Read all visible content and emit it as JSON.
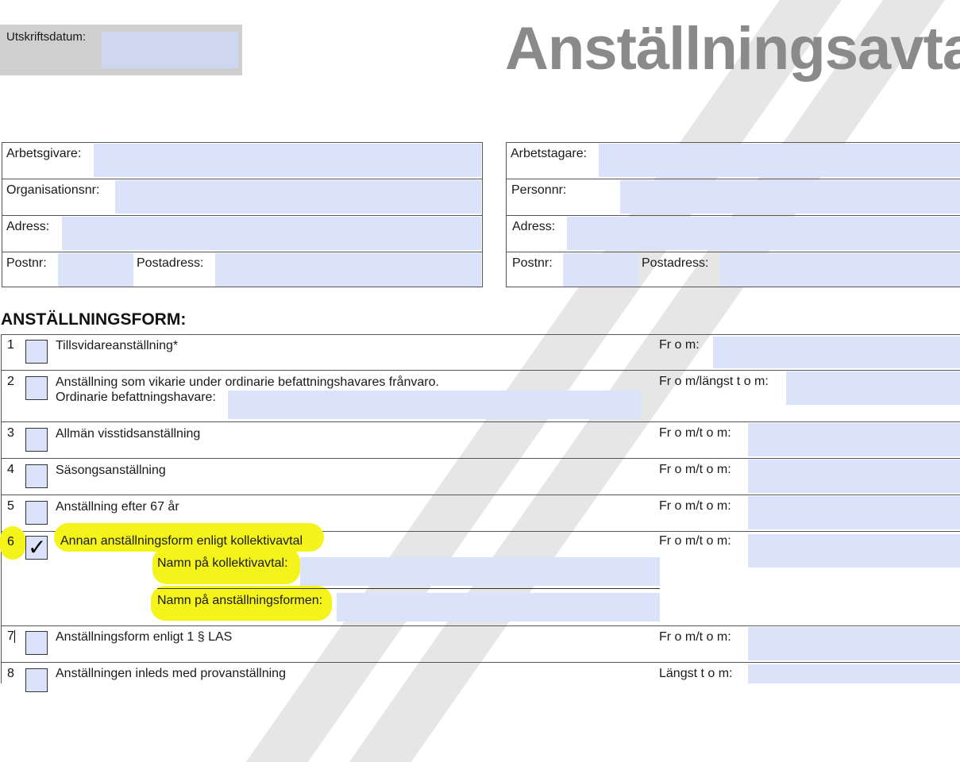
{
  "header": {
    "print_date_label": "Utskriftsdatum:",
    "title": "Anställningsavta"
  },
  "employer": {
    "employer_label": "Arbetsgivare:",
    "org_label": "Organisationsnr:",
    "address_label": "Adress:",
    "postal_code_label": "Postnr:",
    "postal_address_label": "Postadress:"
  },
  "employee": {
    "employee_label": "Arbetstagare:",
    "personal_id_label": "Personnr:",
    "address_label": "Adress:",
    "postal_code_label": "Postnr:",
    "postal_address_label": "Postadress:"
  },
  "section": {
    "title": "ANSTÄLLNINGSFORM:"
  },
  "rows": [
    {
      "num": "1",
      "label": "Tillsvidareanställning*",
      "date_label": "Fr o m:",
      "checked": false
    },
    {
      "num": "2",
      "label": "Anställning som vikarie under ordinarie befattningshavares frånvaro.",
      "sub_label": "Ordinarie befattningshavare:",
      "date_label": "Fr o m/längst t o m:",
      "checked": false
    },
    {
      "num": "3",
      "label": "Allmän visstidsanställning",
      "date_label": "Fr o m/t o m:",
      "checked": false
    },
    {
      "num": "4",
      "label": "Säsongsanställning",
      "date_label": "Fr o m/t o m:",
      "checked": false
    },
    {
      "num": "5",
      "label": "Anställning efter 67 år",
      "date_label": "Fr o m/t o m:",
      "checked": false
    },
    {
      "num": "6",
      "label": "Annan anställningsform enligt kollektivavtal",
      "agreement_label": "Namn på kollektivavtal:",
      "form_label": "Namn på anställningsformen:",
      "date_label": "Fr o m/t o m:",
      "checked": true,
      "check_glyph": "✓"
    },
    {
      "num": "7",
      "label": "Anställningsform enligt 1 § LAS",
      "date_label": "Fr o m/t o m:",
      "checked": false
    },
    {
      "num": "8",
      "label": "Anställningen inleds med provanställning",
      "date_label": "Längst t o m:",
      "checked": false
    }
  ],
  "colors": {
    "field": "#dbe3fb",
    "highlight": "#f4f41a",
    "title": "#8a8a8a"
  }
}
